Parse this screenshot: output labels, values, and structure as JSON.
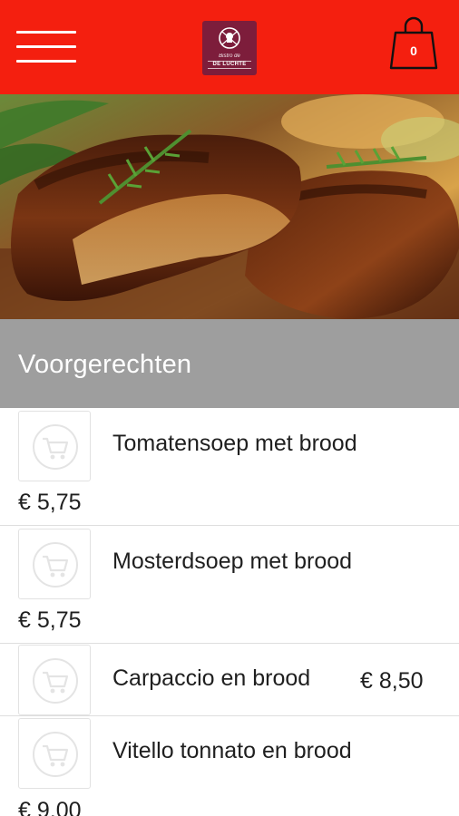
{
  "header": {
    "brand_line1": "Bistro de",
    "brand_line2": "DE LUCHTE",
    "cart_count": "0"
  },
  "category": {
    "title": "Voorgerechten"
  },
  "items": [
    {
      "name": "Tomatensoep met brood",
      "price": "€ 5,75"
    },
    {
      "name": "Mosterdsoep met brood",
      "price": "€ 5,75"
    },
    {
      "name": "Carpaccio en brood",
      "price": "€ 8,50"
    },
    {
      "name": "Vitello tonnato en brood",
      "price": "€ 9,00"
    }
  ],
  "colors": {
    "header_red": "#f41f0f",
    "logo_burgundy": "#7d1d3b",
    "category_grey": "#9e9e9e"
  },
  "icons": [
    "menu-icon",
    "logo-icon",
    "shopping-bag-icon",
    "cart-icon"
  ]
}
